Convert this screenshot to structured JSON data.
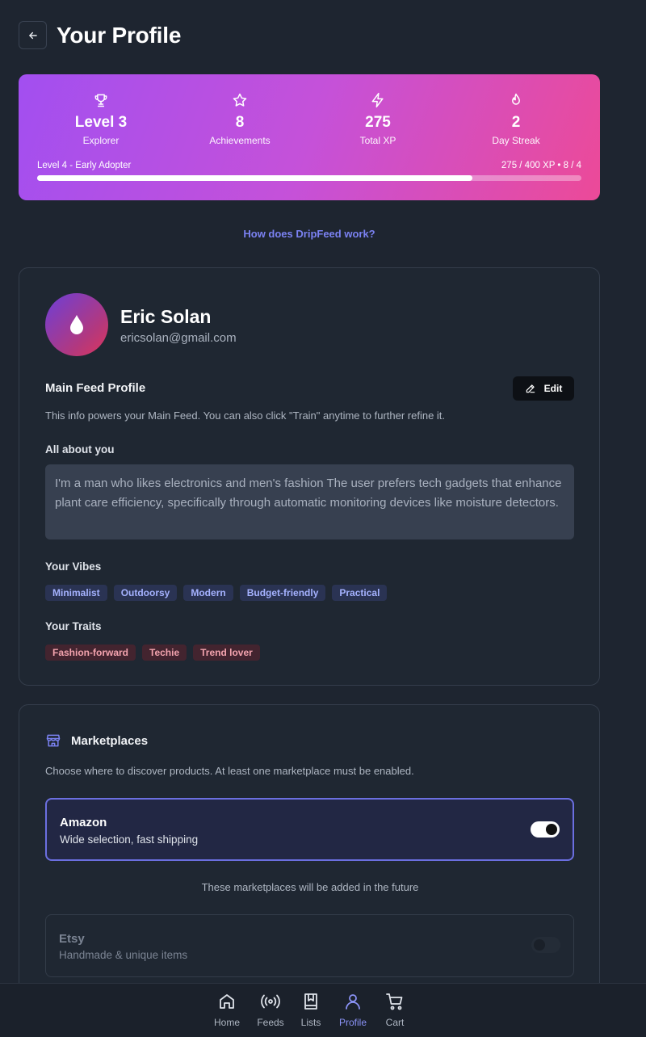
{
  "header": {
    "title": "Your Profile",
    "back_icon": "arrow-left-icon"
  },
  "stats": [
    {
      "icon": "trophy-icon",
      "value": "Level 3",
      "label": "Explorer"
    },
    {
      "icon": "star-icon",
      "value": "8",
      "label": "Achievements"
    },
    {
      "icon": "lightning-icon",
      "value": "275",
      "label": "Total XP"
    },
    {
      "icon": "flame-icon",
      "value": "2",
      "label": "Day Streak"
    }
  ],
  "level_progress": {
    "next_level_label": "Level 4 - Early Adopter",
    "progress_text": "275 / 400 XP • 8 / 4",
    "fraction": 0.8
  },
  "how_link": "How does DripFeed work?",
  "profile": {
    "name": "Eric Solan",
    "email": "ericsolan@gmail.com",
    "main_feed_title": "Main Feed Profile",
    "edit_label": "Edit",
    "main_feed_desc": "This info powers your Main Feed. You can also click \"Train\" anytime to further refine it.",
    "about_title": "All about you",
    "about_text": "I'm a man who likes electronics and men's fashion The user prefers tech gadgets that enhance plant care efficiency, specifically through automatic monitoring devices like moisture detectors.",
    "vibes_title": "Your Vibes",
    "vibes": [
      "Minimalist",
      "Outdoorsy",
      "Modern",
      "Budget-friendly",
      "Practical"
    ],
    "traits_title": "Your Traits",
    "traits": [
      "Fashion-forward",
      "Techie",
      "Trend lover"
    ]
  },
  "marketplaces": {
    "title": "Marketplaces",
    "description": "Choose where to discover products. At least one marketplace must be enabled.",
    "active": {
      "name": "Amazon",
      "subtitle": "Wide selection, fast shipping",
      "enabled": true
    },
    "future_note": "These marketplaces will be added in the future",
    "upcoming": {
      "name": "Etsy",
      "subtitle": "Handmade & unique items",
      "enabled": false
    }
  },
  "nav": [
    {
      "label": "Home",
      "icon": "home-icon",
      "active": false
    },
    {
      "label": "Feeds",
      "icon": "broadcast-icon",
      "active": false
    },
    {
      "label": "Lists",
      "icon": "bookmark-book-icon",
      "active": false
    },
    {
      "label": "Profile",
      "icon": "user-icon",
      "active": true
    },
    {
      "label": "Cart",
      "icon": "cart-icon",
      "active": false
    }
  ],
  "colors": {
    "background": "#1e2530",
    "accent": "#7b82f2",
    "gradient_start": "#a24ff0",
    "gradient_end": "#ec4a98"
  }
}
